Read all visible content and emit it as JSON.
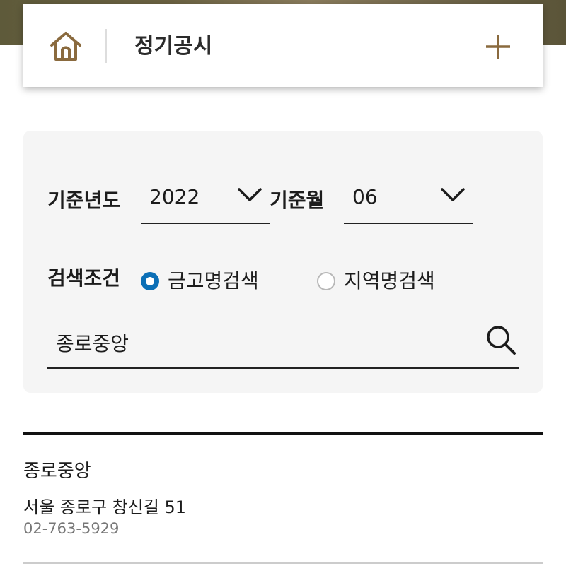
{
  "header": {
    "title": "정기공시",
    "home_icon": "home-icon",
    "add_icon": "plus-icon",
    "accent_color": "#8a6a3e"
  },
  "filters": {
    "year_label": "기준년도",
    "year_value": "2022",
    "month_label": "기준월",
    "month_value": "06",
    "condition_label": "검색조건",
    "options": [
      {
        "label": "금고명검색",
        "selected": true
      },
      {
        "label": "지역명검색",
        "selected": false
      }
    ],
    "radio_color": "#0b6fb6"
  },
  "search": {
    "value": "종로중앙",
    "icon": "search-icon"
  },
  "results": [
    {
      "name": "종로중앙",
      "address": "서울 종로구 창신길 51",
      "phone": "02-763-5929"
    }
  ]
}
